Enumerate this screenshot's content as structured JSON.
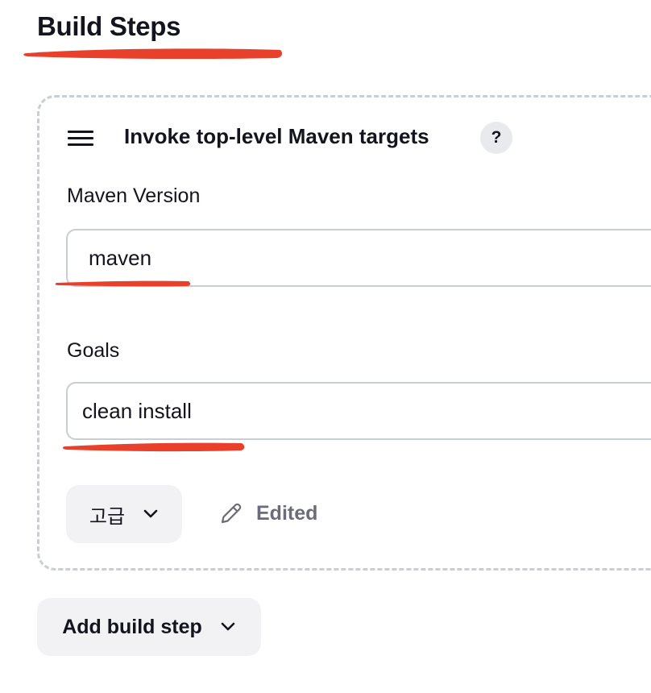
{
  "section": {
    "title": "Build Steps"
  },
  "step": {
    "title": "Invoke top-level Maven targets",
    "help_label": "?",
    "maven_version": {
      "label": "Maven Version",
      "value": "maven"
    },
    "goals": {
      "label": "Goals",
      "value": "clean install"
    },
    "advanced_label": "고급",
    "edited_label": "Edited"
  },
  "add_step": {
    "label": "Add build step"
  },
  "icons": {
    "drag": "drag-handle-icon",
    "help": "help-icon",
    "chevron": "chevron-down-icon",
    "edit": "pencil-icon"
  },
  "colors": {
    "text": "#14141f",
    "muted": "#6b6b7b",
    "border": "#c9ced3",
    "button_bg": "#f2f2f4",
    "help_bg": "#e9eaed",
    "annotation_red": "#e8402a"
  }
}
